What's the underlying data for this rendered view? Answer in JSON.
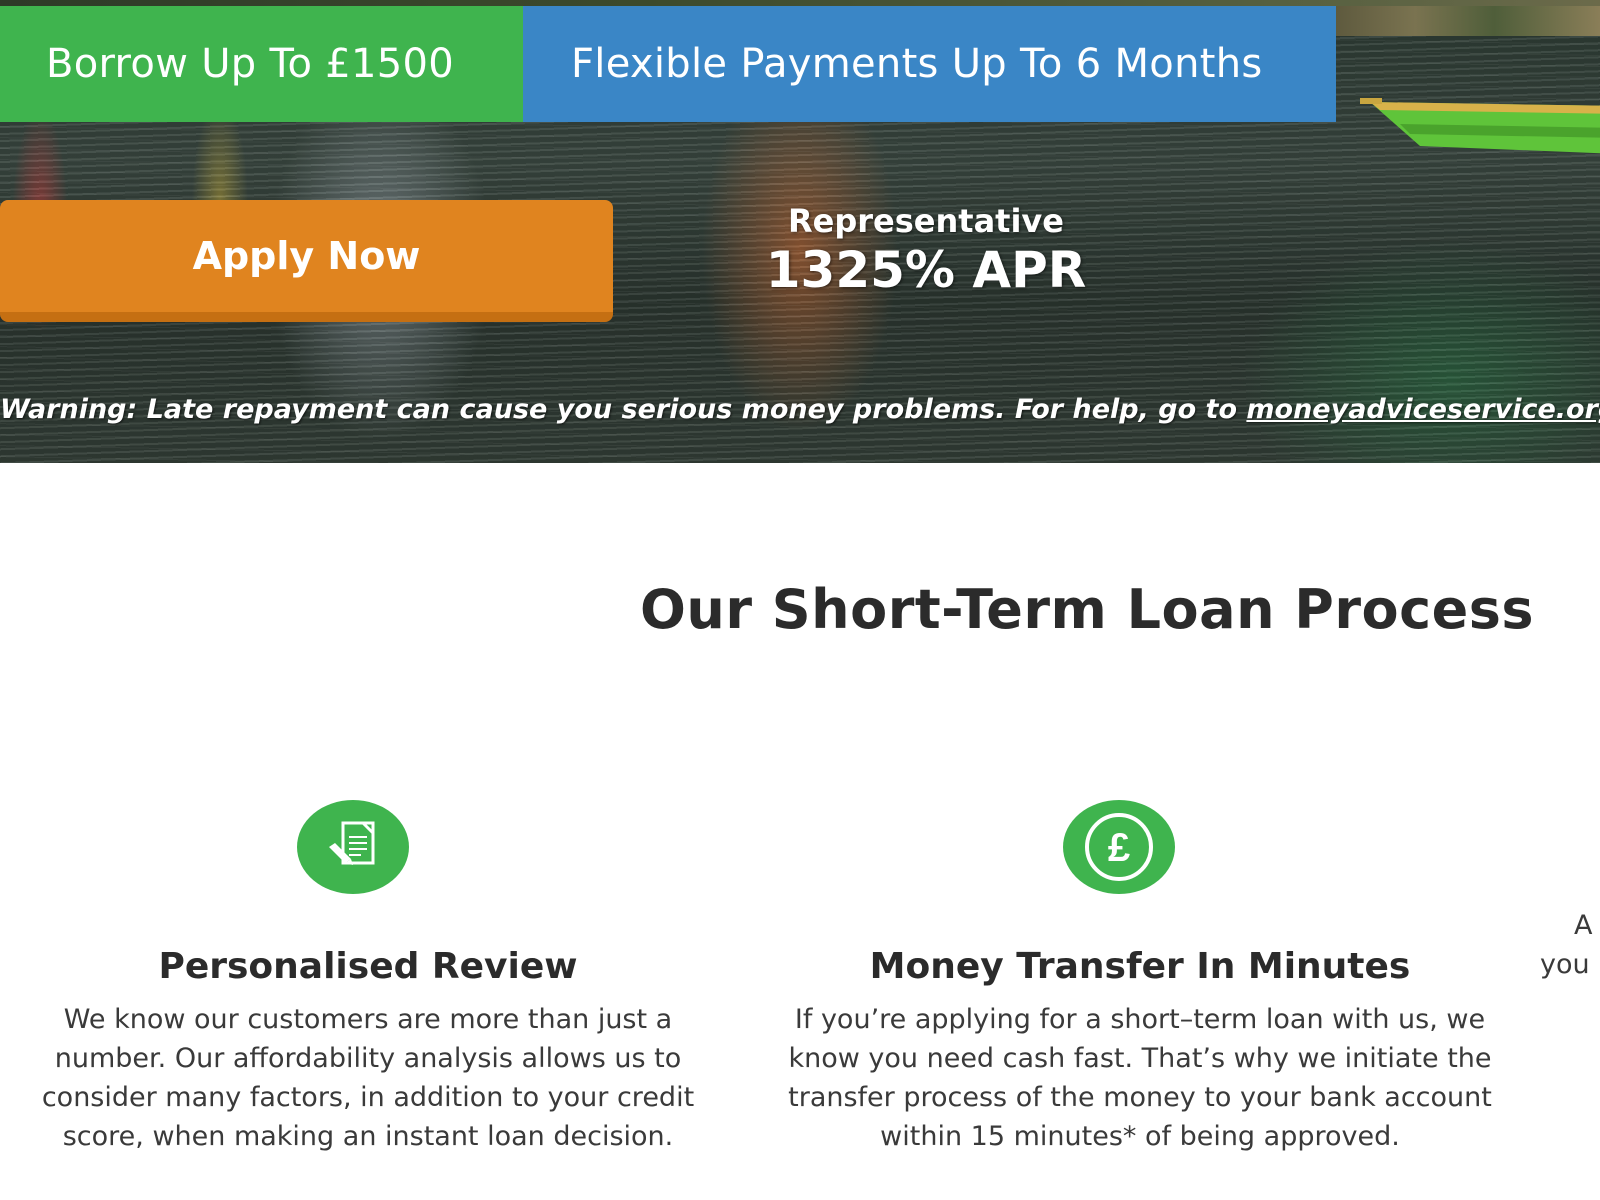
{
  "hero": {
    "banner_borrow": "Borrow Up To £1500",
    "banner_flexible": "Flexible Payments Up To 6 Months",
    "apply_button": "Apply Now",
    "apr_label": "Representative",
    "apr_value": "1325% APR",
    "warning_text": "Warning: Late repayment can cause you serious money problems. For help, go to ",
    "warning_link": "moneyadviceservice.org.uk."
  },
  "process": {
    "title": "Our Short-Term Loan Process",
    "cards": [
      {
        "icon": "document-pen-icon",
        "title": "Personalised Review",
        "text": "We know our customers are more than just a number. Our affordability analysis allows us to consider many factors, in addition to your credit score, when making an instant loan decision."
      },
      {
        "icon": "pound-coin-icon",
        "title": "Money Transfer In Minutes",
        "text": "If you’re applying for a short–term loan with us, we know you need cash fast. That’s why we initiate the transfer process of the money to your bank account within 15 minutes* of being approved."
      },
      {
        "text_line1": "A",
        "text_line2": "you"
      }
    ]
  },
  "colors": {
    "green": "#3fb44e",
    "blue": "#3a86c6",
    "orange": "#e0841f",
    "heading": "#2b2b2b"
  }
}
